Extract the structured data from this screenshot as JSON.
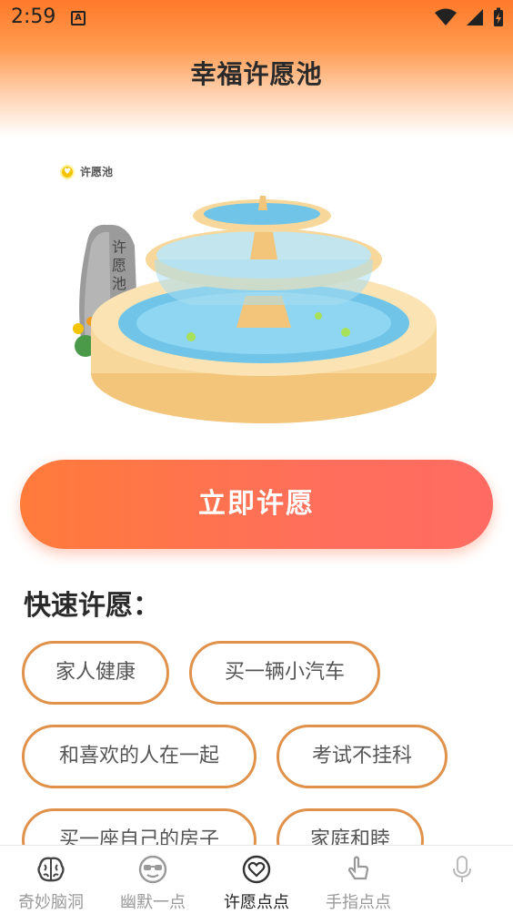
{
  "status_bar": {
    "time": "2:59",
    "notification_icon": "A"
  },
  "header": {
    "title": "幸福许愿池"
  },
  "fountain": {
    "badge_label": "许愿池",
    "stone_text": [
      "许",
      "愿",
      "池"
    ]
  },
  "wish_button": {
    "label": "立即许愿"
  },
  "quick_wish": {
    "title": "快速许愿：",
    "chips": [
      {
        "label": "家人健康"
      },
      {
        "label": "买一辆小汽车"
      },
      {
        "label": "和喜欢的人在一起"
      },
      {
        "label": "考试不挂科"
      },
      {
        "label": "买一座自己的房子"
      },
      {
        "label": "家庭和睦"
      }
    ]
  },
  "tabbar": {
    "items": [
      {
        "label": "奇妙脑洞",
        "icon": "brain-icon"
      },
      {
        "label": "幽默一点",
        "icon": "sunglasses-face-icon"
      },
      {
        "label": "许愿点点",
        "icon": "heart-icon",
        "active": true
      },
      {
        "label": "手指点点",
        "icon": "pointing-hand-icon"
      },
      {
        "label": "",
        "icon": "microphone-icon"
      }
    ]
  },
  "colors": {
    "accent": "#ff7b3a",
    "chip_border": "#e0914a",
    "header_top": "#ff7a2a"
  }
}
